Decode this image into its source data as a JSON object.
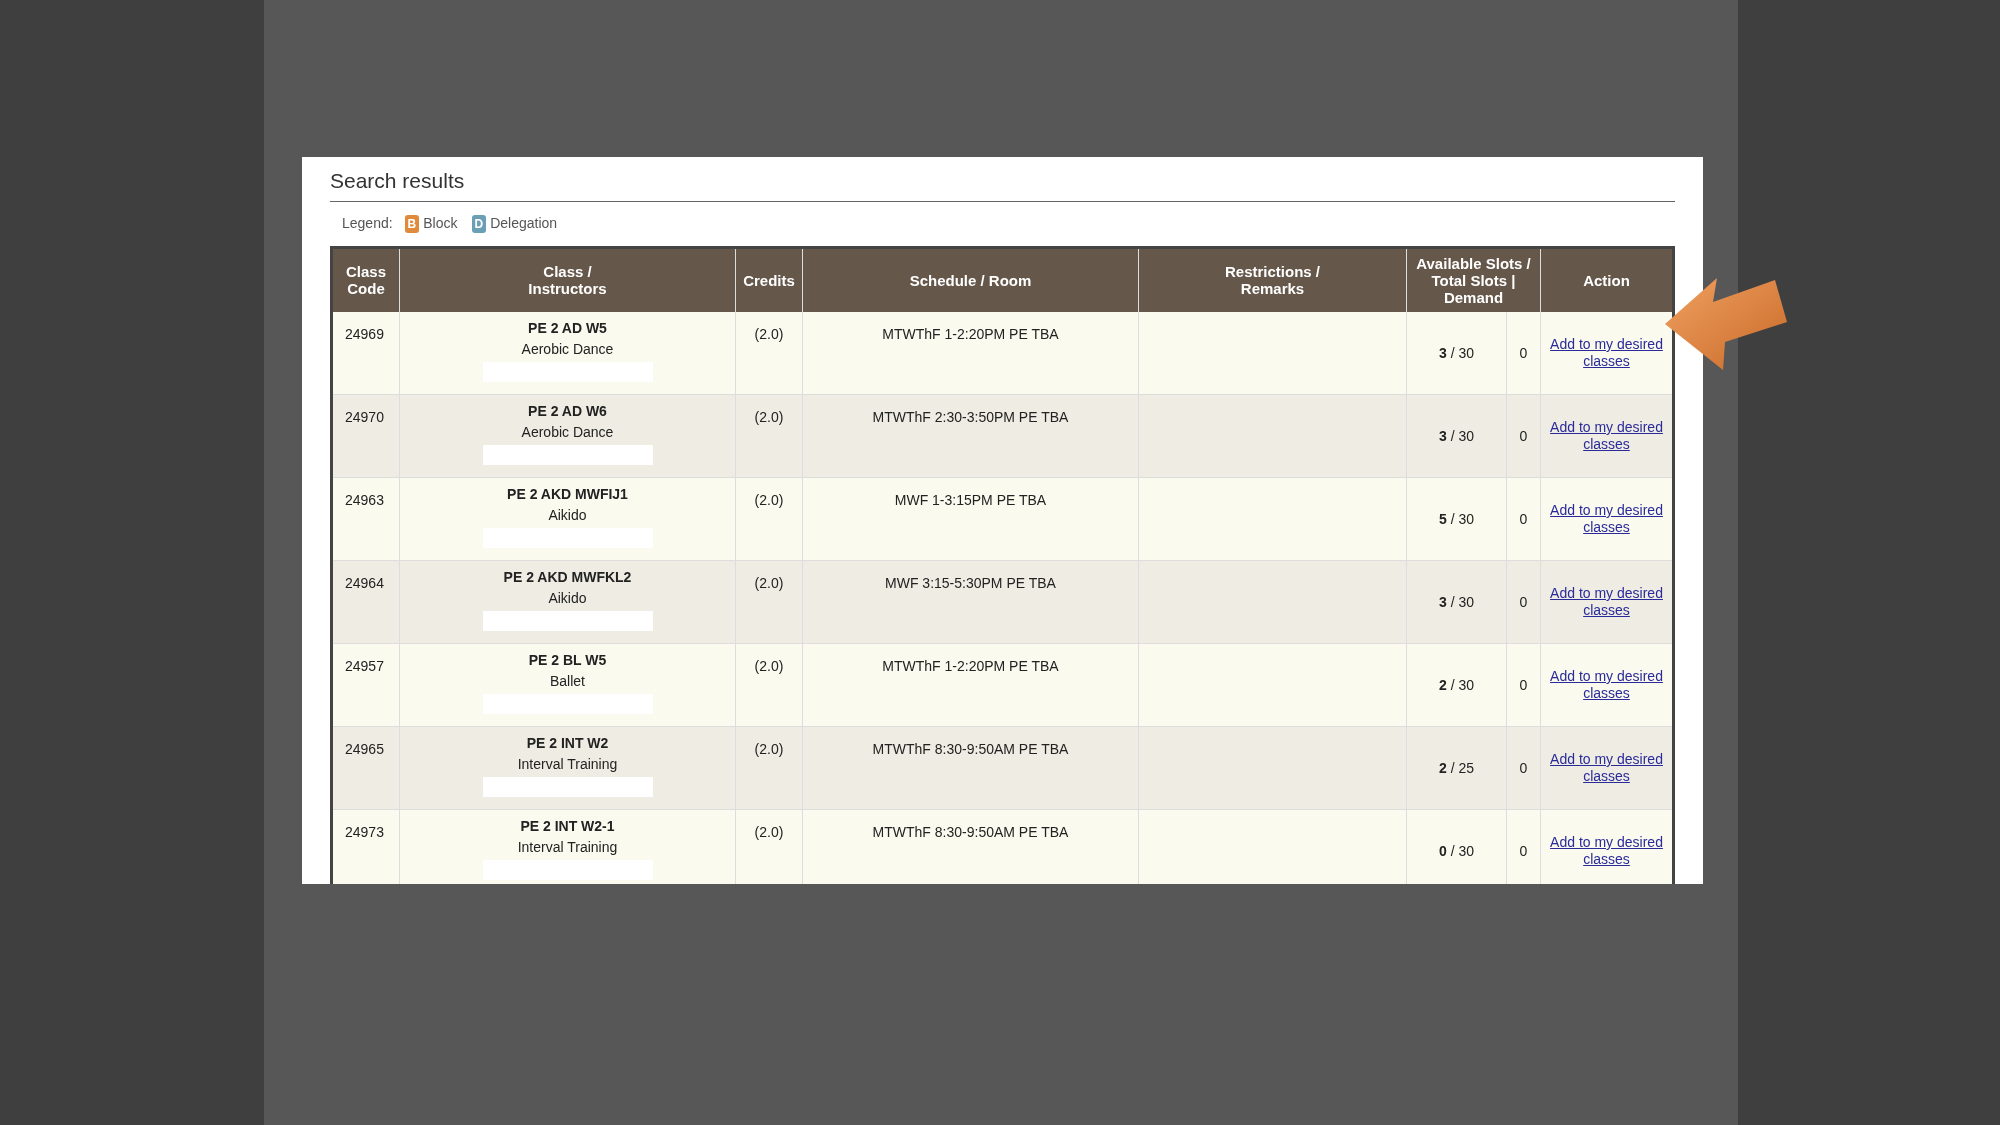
{
  "title": "Search results",
  "legend": {
    "label": "Legend:",
    "items": [
      {
        "letter": "B",
        "name": "Block",
        "color": "#e08a3c"
      },
      {
        "letter": "D",
        "name": "Delegation",
        "color": "#6b9fb5"
      }
    ]
  },
  "table": {
    "columns": [
      "Class\nCode",
      "Class /\nInstructors",
      "Credits",
      "Schedule / Room",
      "Restrictions /\nRemarks",
      "Available Slots /\nTotal Slots |\nDemand",
      "Action"
    ],
    "rows": [
      {
        "code": "24969",
        "class": "PE 2 AD W5",
        "title": "Aerobic Dance",
        "credits": "(2.0)",
        "schedule": "MTWThF 1-2:20PM PE TBA",
        "slots": "**3** / 30",
        "demand": "0",
        "action": "Add to my desired classes"
      },
      {
        "code": "24970",
        "class": "PE 2 AD W6",
        "title": "Aerobic Dance",
        "credits": "(2.0)",
        "schedule": "MTWThF 2:30-3:50PM PE TBA",
        "slots": "**3** / 30",
        "demand": "0",
        "action": "Add to my desired classes"
      },
      {
        "code": "24963",
        "class": "PE 2 AKD MWFIJ1",
        "title": "Aikido",
        "credits": "(2.0)",
        "schedule": "MWF 1-3:15PM PE TBA",
        "slots": "**5** / 30",
        "demand": "0",
        "action": "Add to my desired classes"
      },
      {
        "code": "24964",
        "class": "PE 2 AKD MWFKL2",
        "title": "Aikido",
        "credits": "(2.0)",
        "schedule": "MWF 3:15-5:30PM PE TBA",
        "slots": "**3** / 30",
        "demand": "0",
        "action": "Add to my desired classes"
      },
      {
        "code": "24957",
        "class": "PE 2 BL W5",
        "title": "Ballet",
        "credits": "(2.0)",
        "schedule": "MTWThF 1-2:20PM PE TBA",
        "slots": "**2** / 30",
        "demand": "0",
        "action": "Add to my desired classes"
      },
      {
        "code": "24965",
        "class": "PE 2 INT W2",
        "title": "Interval Training",
        "credits": "(2.0)",
        "schedule": "MTWThF 8:30-9:50AM PE TBA",
        "slots": "**2** / 25",
        "demand": "0",
        "action": "Add to my desired classes"
      },
      {
        "code": "24973",
        "class": "PE 2 INT W2-1",
        "title": "Interval Training",
        "credits": "(2.0)",
        "schedule": "MTWThF 8:30-9:50AM PE TBA",
        "slots": "**0** / 30",
        "demand": "0",
        "action": "Add to my desired classes"
      }
    ]
  }
}
